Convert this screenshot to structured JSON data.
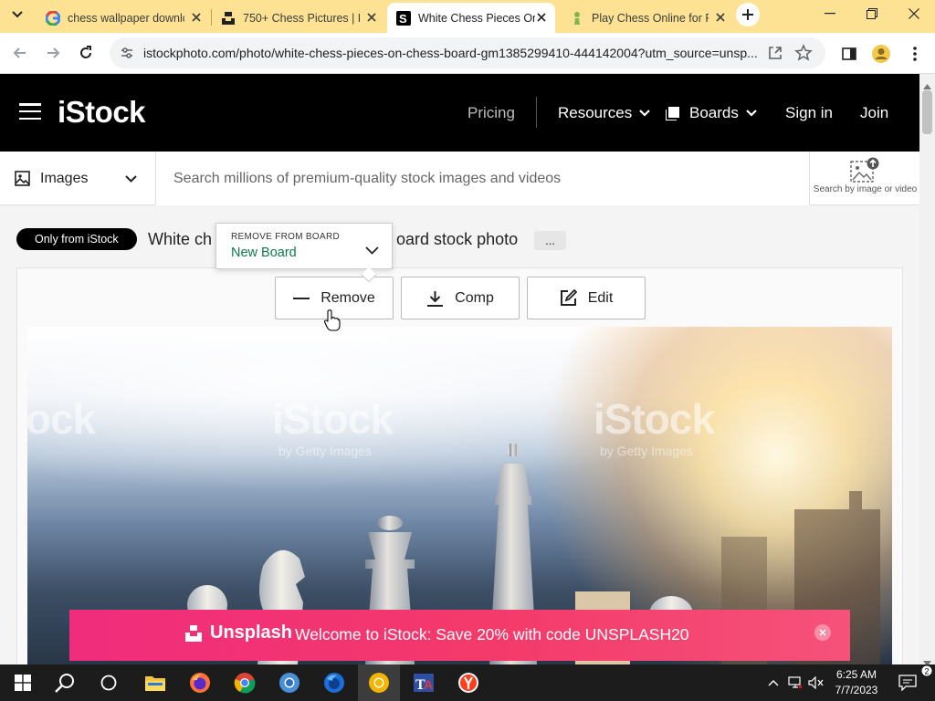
{
  "browser": {
    "tabs": [
      {
        "title": "chess wallpaper downlo",
        "favicon": "google-icon"
      },
      {
        "title": "750+ Chess Pictures | D",
        "favicon": "unsplash-icon"
      },
      {
        "title": "White Chess Pieces On",
        "favicon": "istock-icon",
        "active": true
      },
      {
        "title": "Play Chess Online for F",
        "favicon": "chess-pawn-icon"
      }
    ],
    "url": "istockphoto.com/photo/white-chess-pieces-on-chess-board-gm1385299410-444142004?utm_source=unsp..."
  },
  "header": {
    "logo": "iStock",
    "nav": {
      "pricing": "Pricing",
      "resources": "Resources",
      "boards": "Boards",
      "sign_in": "Sign in",
      "join": "Join"
    }
  },
  "search": {
    "type": "Images",
    "placeholder": "Search millions of premium-quality stock images and videos",
    "by_image_label": "Search by image or video"
  },
  "asset": {
    "badge": "Only from iStock",
    "title": "White chess pieces on chess board stock photo",
    "title_visible_start": "White ch",
    "title_visible_end": "oard stock photo",
    "more": "...",
    "board_popover": {
      "caption": "REMOVE FROM BOARD",
      "board_name": "New Board"
    },
    "actions": {
      "remove": "Remove",
      "comp": "Comp",
      "edit": "Edit"
    },
    "watermark": "iStock",
    "watermark_sub": "by Getty Images",
    "watermark_partial_left": "ock"
  },
  "promo": {
    "brand": "Unsplash",
    "message": "Welcome to iStock: Save 20% with code UNSPLASH20"
  },
  "taskbar": {
    "time": "6:25 AM",
    "date": "7/7/2023"
  },
  "colors": {
    "tab_strip": "#fde293",
    "istock_header": "#000000",
    "board_name_green": "#0c7a4b",
    "promo_pink": "#f02c7c"
  }
}
